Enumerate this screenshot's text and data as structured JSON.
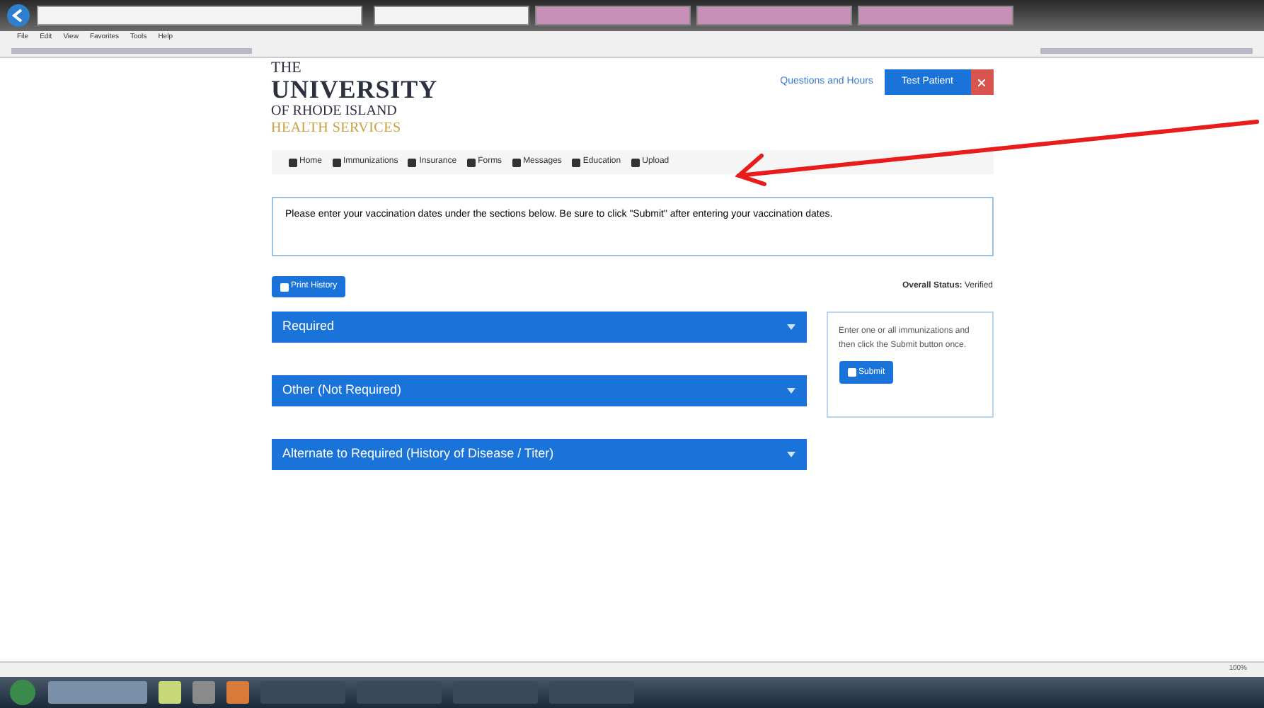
{
  "browser": {
    "menu": [
      "File",
      "Edit",
      "View",
      "Favorites",
      "Tools",
      "Help"
    ],
    "tabs": [
      {
        "selected": true
      },
      {
        "selected": false
      },
      {
        "selected": false
      },
      {
        "selected": false
      }
    ],
    "zoom": "100%"
  },
  "logo": {
    "line_1": "THE",
    "line_2": "UNIVERSITY",
    "line_3": "OF RHODE ISLAND",
    "line_4": "HEALTH SERVICES"
  },
  "header": {
    "help_link": "Questions and Hours",
    "user_button": "Test Patient"
  },
  "nav": [
    "Home",
    "Immunizations",
    "Insurance",
    "Forms",
    "Messages",
    "Education",
    "Upload"
  ],
  "notice": "Please enter your vaccination dates under the sections below.  Be sure to click \"Submit\" after entering your vaccination dates.",
  "print_button": "Print History",
  "overall_status": {
    "label": "Overall Status:",
    "value": "Verified"
  },
  "sections": [
    {
      "title": "Required",
      "expanded": false
    },
    {
      "title": "Other (Not Required)",
      "expanded": false
    },
    {
      "title": "Alternate to Required (History of Disease / Titer)",
      "expanded": false
    }
  ],
  "side_box": {
    "text": "Enter one or all immunizations and then click the Submit button once.",
    "button": "Submit"
  }
}
